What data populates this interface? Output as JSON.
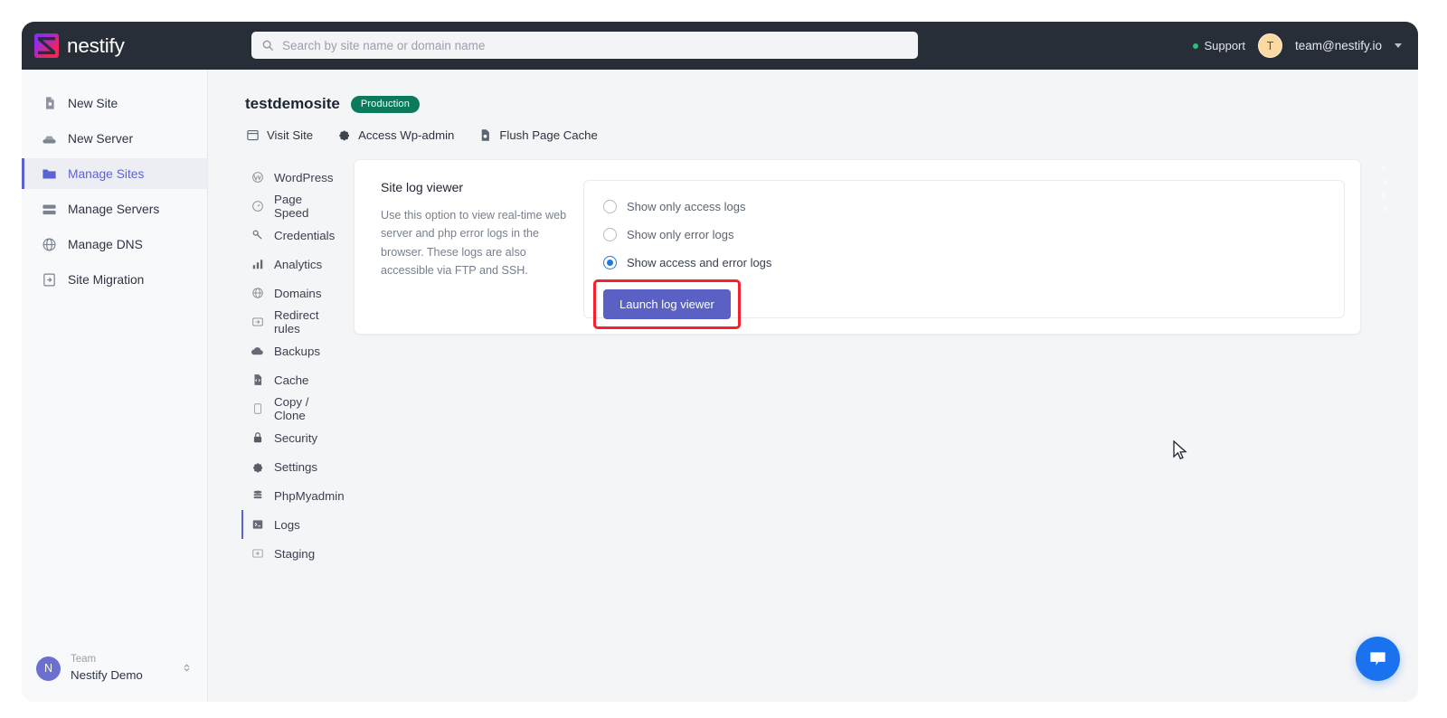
{
  "brand": {
    "name": "nestify",
    "logo_icon": "nestify-logo-icon"
  },
  "search": {
    "placeholder": "Search by site name or domain name",
    "value": "",
    "icon": "search-icon"
  },
  "topbar": {
    "support_label": "Support",
    "account_email": "team@nestify.io",
    "avatar_initial": "T",
    "status_color": "#27c07a"
  },
  "sidebar": {
    "items": [
      {
        "label": "New Site",
        "icon": "file-plus-icon",
        "active": false
      },
      {
        "label": "New Server",
        "icon": "server-icon",
        "active": false
      },
      {
        "label": "Manage Sites",
        "icon": "folder-icon",
        "active": true
      },
      {
        "label": "Manage Servers",
        "icon": "servers-stack-icon",
        "active": false
      },
      {
        "label": "Manage DNS",
        "icon": "globe-icon",
        "active": false
      },
      {
        "label": "Site Migration",
        "icon": "migration-icon",
        "active": false
      }
    ],
    "user": {
      "team_label": "Team",
      "team_name": "Nestify Demo",
      "avatar_initial": "N"
    }
  },
  "page": {
    "site_name": "testdemosite",
    "environment_badge": "Production",
    "badge_color": "#0c7a5d",
    "quick_actions": [
      {
        "label": "Visit Site",
        "icon": "browser-window-icon"
      },
      {
        "label": "Access Wp-admin",
        "icon": "gear-icon"
      },
      {
        "label": "Flush Page Cache",
        "icon": "file-cache-icon"
      }
    ]
  },
  "subnav": {
    "items": [
      {
        "label": "WordPress",
        "icon": "wordpress-icon",
        "active": false
      },
      {
        "label": "Page Speed",
        "icon": "speedometer-icon",
        "active": false
      },
      {
        "label": "Credentials",
        "icon": "key-icon",
        "active": false
      },
      {
        "label": "Analytics",
        "icon": "bar-chart-icon",
        "active": false
      },
      {
        "label": "Domains",
        "icon": "globe-icon",
        "active": false
      },
      {
        "label": "Redirect rules",
        "icon": "redirect-icon",
        "active": false
      },
      {
        "label": "Backups",
        "icon": "cloud-icon",
        "active": false
      },
      {
        "label": "Cache",
        "icon": "file-code-icon",
        "active": false
      },
      {
        "label": "Copy / Clone",
        "icon": "copy-icon",
        "active": false
      },
      {
        "label": "Security",
        "icon": "lock-icon",
        "active": false
      },
      {
        "label": "Settings",
        "icon": "gear-icon",
        "active": false
      },
      {
        "label": "PhpMyadmin",
        "icon": "database-icon",
        "active": false
      },
      {
        "label": "Logs",
        "icon": "terminal-icon",
        "active": true
      },
      {
        "label": "Staging",
        "icon": "staging-icon",
        "active": false
      }
    ]
  },
  "card": {
    "heading": "Site log viewer",
    "description": "Use this option to view real-time web server and php error logs in the browser. These logs are also accessible via FTP and SSH.",
    "options": [
      {
        "label": "Show only access logs",
        "selected": false
      },
      {
        "label": "Show only error logs",
        "selected": false
      },
      {
        "label": "Show access and error logs",
        "selected": true
      }
    ],
    "button_label": "Launch log viewer",
    "button_color": "#5a60c4",
    "annotation_color": "#f4212e"
  },
  "chat_widget": {
    "icon": "chat-bubble-icon",
    "color": "#1b72ef"
  },
  "toast_closers": [
    {
      "icon": "close-icon",
      "label": "×"
    },
    {
      "icon": "close-icon",
      "label": "×"
    },
    {
      "icon": "close-icon",
      "label": "×"
    },
    {
      "icon": "close-icon",
      "label": "×"
    }
  ]
}
